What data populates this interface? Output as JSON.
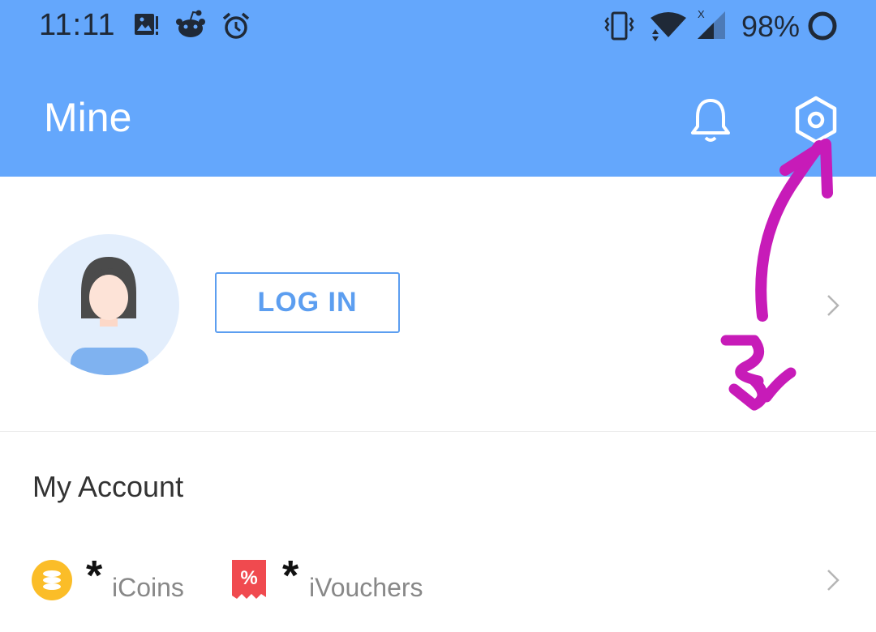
{
  "status_bar": {
    "time": "11:11",
    "battery": "98%",
    "icons": [
      "gallery-icon",
      "reddit-icon",
      "alarm-icon",
      "vibrate-icon",
      "wifi-icon",
      "signal-icon",
      "battery-icon"
    ]
  },
  "header": {
    "title": "Mine",
    "icons": [
      "bell-icon",
      "settings-icon"
    ],
    "color": "#64a7fc"
  },
  "profile": {
    "login_label": "LOG IN",
    "avatar_icon": "user-avatar-icon"
  },
  "account": {
    "title": "My Account",
    "wallet": [
      {
        "icon": "coin-icon",
        "value": "*",
        "label": "iCoins"
      },
      {
        "icon": "voucher-icon",
        "value": "*",
        "label": "iVouchers"
      }
    ]
  },
  "annotation": {
    "color": "#c71bb8"
  }
}
